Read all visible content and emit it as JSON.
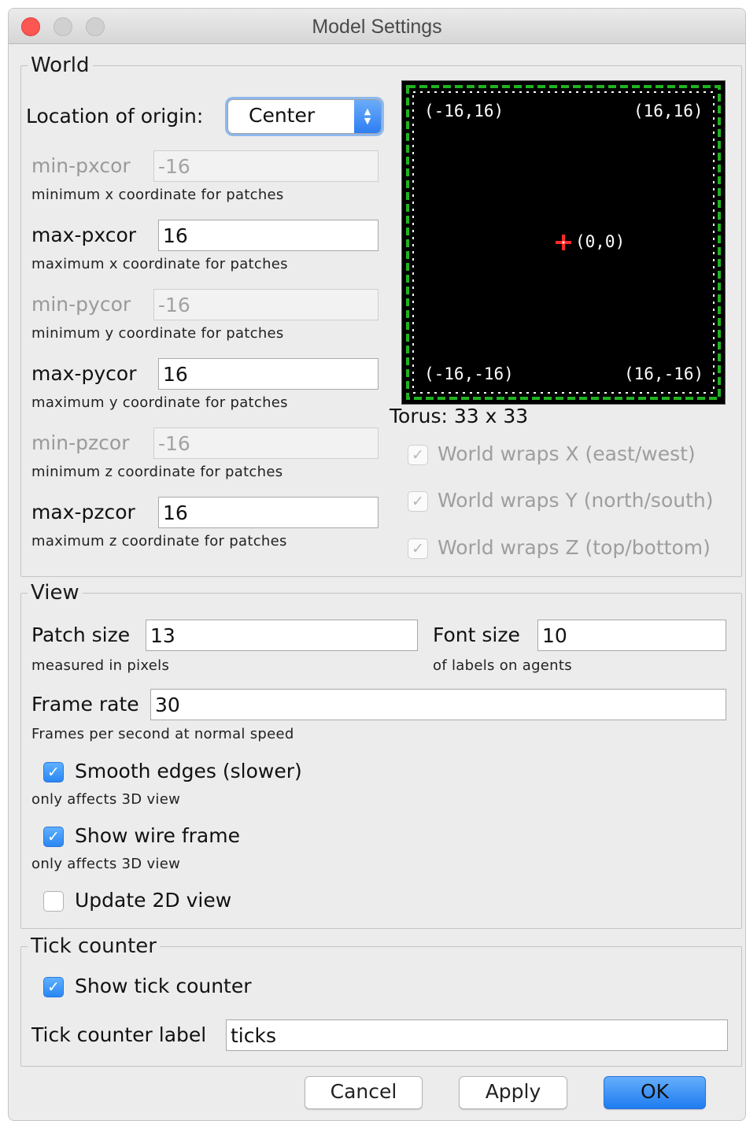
{
  "window": {
    "title": "Model Settings"
  },
  "world": {
    "legend": "World",
    "origin_label": "Location of origin:",
    "origin_value": "Center",
    "fields": [
      {
        "label": "min-pxcor",
        "value": "-16",
        "hint": "minimum x coordinate for patches",
        "enabled": false
      },
      {
        "label": "max-pxcor",
        "value": "16",
        "hint": "maximum x coordinate for patches",
        "enabled": true
      },
      {
        "label": "min-pycor",
        "value": "-16",
        "hint": "minimum y coordinate for patches",
        "enabled": false
      },
      {
        "label": "max-pycor",
        "value": "16",
        "hint": "maximum y coordinate for patches",
        "enabled": true
      },
      {
        "label": "min-pzcor",
        "value": "-16",
        "hint": "minimum z coordinate for patches",
        "enabled": false
      },
      {
        "label": "max-pzcor",
        "value": "16",
        "hint": "maximum z coordinate for patches",
        "enabled": true
      }
    ],
    "preview": {
      "top_left": "(-16,16)",
      "top_right": "(16,16)",
      "center": "(0,0)",
      "bottom_left": "(-16,-16)",
      "bottom_right": "(16,-16)",
      "border_color": "#1fb31f",
      "origin_color": "#ff2a2a"
    },
    "torus_label": "Torus: 33 x 33",
    "wraps": [
      {
        "label": "World wraps X (east/west)",
        "checked": true
      },
      {
        "label": "World wraps Y (north/south)",
        "checked": true
      },
      {
        "label": "World wraps Z (top/bottom)",
        "checked": true
      }
    ]
  },
  "view": {
    "legend": "View",
    "patch_size_label": "Patch size",
    "patch_size_value": "13",
    "patch_size_hint": "measured in pixels",
    "font_size_label": "Font size",
    "font_size_value": "10",
    "font_size_hint": "of labels on agents",
    "frame_rate_label": "Frame rate",
    "frame_rate_value": "30",
    "frame_rate_hint": "Frames per second at normal speed",
    "smooth_edges_label": "Smooth edges (slower)",
    "smooth_edges_hint": "only affects 3D view",
    "wire_frame_label": "Show wire frame",
    "wire_frame_hint": "only affects 3D view",
    "update_2d_label": "Update 2D view"
  },
  "tick": {
    "legend": "Tick counter",
    "show_label": "Show tick counter",
    "label_label": "Tick counter label",
    "label_value": "ticks"
  },
  "buttons": {
    "cancel": "Cancel",
    "apply": "Apply",
    "ok": "OK"
  }
}
